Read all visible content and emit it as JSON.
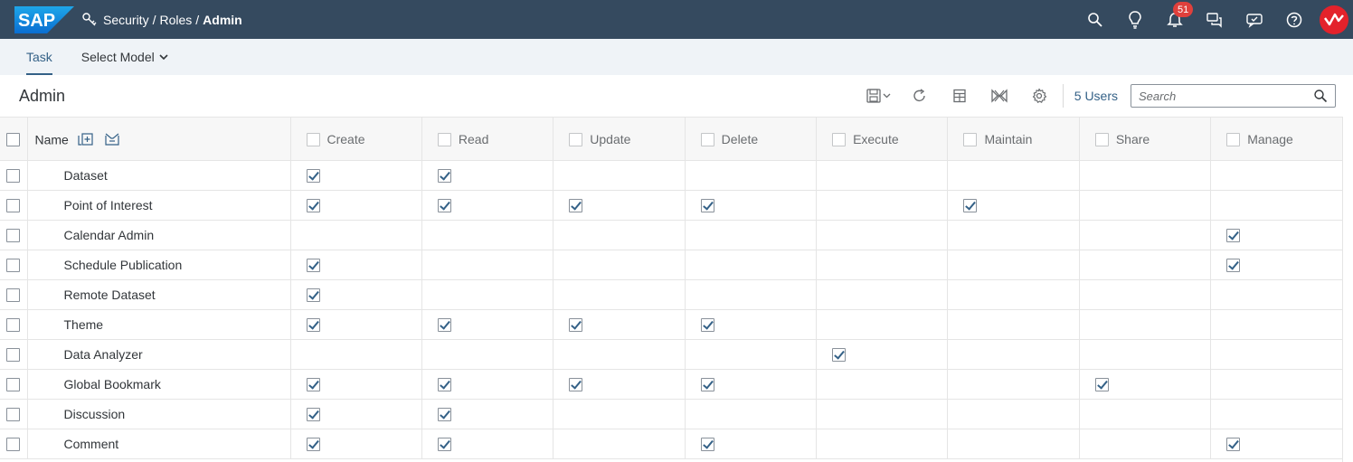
{
  "shell": {
    "logo_text": "SAP",
    "breadcrumb": [
      "Security",
      "Roles",
      "Admin"
    ],
    "notifications_count": "51",
    "icons": [
      "search-icon",
      "lightbulb-icon",
      "bell-icon",
      "discussion-icon",
      "feedback-icon",
      "help-icon",
      "profile-avatar"
    ]
  },
  "tabs": {
    "task_label": "Task",
    "select_model_label": "Select Model"
  },
  "toolbar": {
    "title": "Admin",
    "users_label": "5 Users",
    "search_placeholder": "Search"
  },
  "table": {
    "name_header": "Name",
    "columns": [
      "Create",
      "Read",
      "Update",
      "Delete",
      "Execute",
      "Maintain",
      "Share",
      "Manage"
    ],
    "rows": [
      {
        "name": "Dataset",
        "perms": [
          1,
          1,
          0,
          0,
          0,
          0,
          0,
          0
        ]
      },
      {
        "name": "Point of Interest",
        "perms": [
          1,
          1,
          1,
          1,
          0,
          1,
          0,
          0
        ]
      },
      {
        "name": "Calendar Admin",
        "perms": [
          0,
          0,
          0,
          0,
          0,
          0,
          0,
          1
        ]
      },
      {
        "name": "Schedule Publication",
        "perms": [
          1,
          0,
          0,
          0,
          0,
          0,
          0,
          1
        ]
      },
      {
        "name": "Remote Dataset",
        "perms": [
          1,
          0,
          0,
          0,
          0,
          0,
          0,
          0
        ]
      },
      {
        "name": "Theme",
        "perms": [
          1,
          1,
          1,
          1,
          0,
          0,
          0,
          0
        ]
      },
      {
        "name": "Data Analyzer",
        "perms": [
          0,
          0,
          0,
          0,
          1,
          0,
          0,
          0
        ]
      },
      {
        "name": "Global Bookmark",
        "perms": [
          1,
          1,
          1,
          1,
          0,
          0,
          1,
          0
        ]
      },
      {
        "name": "Discussion",
        "perms": [
          1,
          1,
          0,
          0,
          0,
          0,
          0,
          0
        ]
      },
      {
        "name": "Comment",
        "perms": [
          1,
          1,
          0,
          1,
          0,
          0,
          0,
          1
        ]
      }
    ]
  },
  "colors": {
    "shell_bg": "#354a5f",
    "accent": "#346187",
    "badge": "#e0403c",
    "avatar": "#e3222b"
  }
}
